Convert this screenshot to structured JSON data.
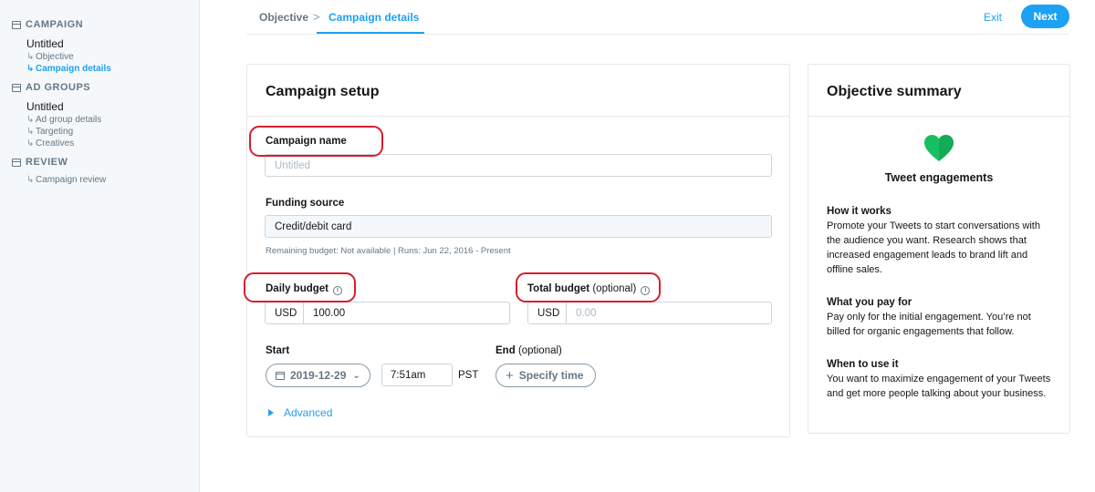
{
  "sidebar": {
    "campaign": {
      "heading": "CAMPAIGN",
      "title": "Untitled",
      "items": [
        "Objective",
        "Campaign details"
      ]
    },
    "ad_groups": {
      "heading": "AD GROUPS",
      "title": "Untitled",
      "items": [
        "Ad group details",
        "Targeting",
        "Creatives"
      ]
    },
    "review": {
      "heading": "REVIEW",
      "items": [
        "Campaign review"
      ]
    },
    "arrow": "↳"
  },
  "topnav": {
    "crumbs": [
      "Objective",
      "Campaign details"
    ],
    "separator": ">",
    "exit": "Exit",
    "next": "Next"
  },
  "setup": {
    "heading": "Campaign setup",
    "campaign_name": {
      "label": "Campaign name",
      "placeholder": "Untitled"
    },
    "funding": {
      "label": "Funding source",
      "value": "Credit/debit card",
      "hint": "Remaining budget: Not available | Runs: Jun 22, 2016 - Present"
    },
    "daily_budget": {
      "label": "Daily budget",
      "currency": "USD",
      "value": "100.00"
    },
    "total_budget": {
      "label": "Total budget",
      "optional": "(optional)",
      "currency": "USD",
      "placeholder": "0.00"
    },
    "start": {
      "label": "Start",
      "date": "2019-12-29",
      "time": "7:51am",
      "timezone": "PST"
    },
    "end": {
      "label": "End",
      "optional": "(optional)",
      "button": "Specify time"
    },
    "advanced": "Advanced"
  },
  "summary": {
    "heading": "Objective summary",
    "objective": "Tweet engagements",
    "sections": [
      {
        "title": "How it works",
        "body": "Promote your Tweets to start conversations with the audience you want. Research shows that increased engagement leads to brand lift and offline sales."
      },
      {
        "title": "What you pay for",
        "body": "Pay only for the initial engagement. You’re not billed for organic engagements that follow."
      },
      {
        "title": "When to use it",
        "body": "You want to maximize engagement of your Tweets and get more people talking about your business."
      }
    ]
  },
  "colors": {
    "accent": "#1da1f2",
    "highlight": "#d61f2c",
    "heart": "#17bf63"
  },
  "icons": [
    "list-icon",
    "info-icon",
    "calendar-icon",
    "chevron-down-icon",
    "plus-icon",
    "caret-right-icon",
    "heart-icon"
  ]
}
